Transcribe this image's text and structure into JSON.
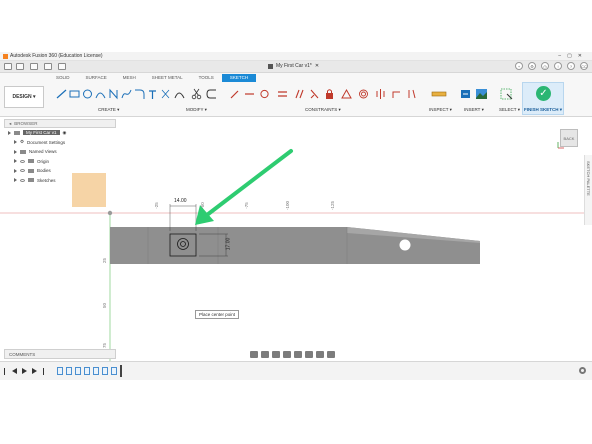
{
  "window": {
    "title": "Autodesk Fusion 360 (Education License)"
  },
  "document": {
    "name": "My First Car v1*"
  },
  "tabs": [
    "SOLID",
    "SURFACE",
    "MESH",
    "SHEET METAL",
    "TOOLS",
    "SKETCH"
  ],
  "active_tab": "SKETCH",
  "workspace_button": "DESIGN",
  "groups": {
    "create": "CREATE",
    "modify": "MODIFY",
    "constraints": "CONSTRAINTS",
    "inspect": "INSPECT",
    "insert": "INSERT",
    "select": "SELECT",
    "finish": "FINISH SKETCH"
  },
  "browser": {
    "header": "BROWSER",
    "root": "My First Car v1",
    "items": [
      "Document Settings",
      "Named Views",
      "Origin",
      "Bodies",
      "Sketches"
    ]
  },
  "comments_label": "COMMENTS",
  "viewcube_label": "BACK",
  "sketch_palette_label": "SKETCH PALETTE",
  "ruler": {
    "top_ticks": [
      "-25",
      "-50",
      "-75",
      "-100",
      "-125"
    ],
    "left_ticks": [
      "25",
      "50",
      "75"
    ]
  },
  "dimensions": {
    "width": "14.00",
    "height": "17.00"
  },
  "tooltip": "Place center point",
  "colors": {
    "accent": "#1b8ad6",
    "finish_check": "#2bb673",
    "arrow": "#2ecc71",
    "body": "#8a8a8a",
    "plane": "#f6d4a6"
  }
}
